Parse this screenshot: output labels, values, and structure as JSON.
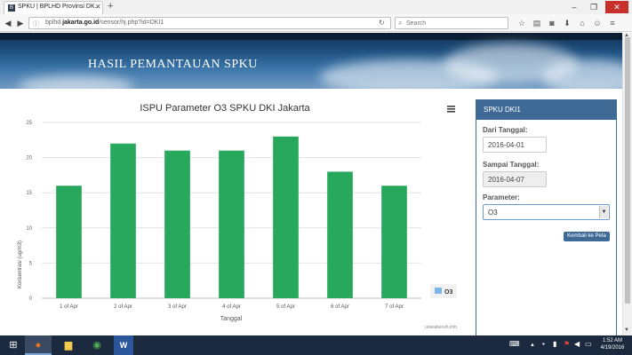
{
  "browser": {
    "tab_title": "SPKU | BPLHD Provinsi DK...",
    "url_prefix": "bplhd.",
    "url_domain": "jakarta.go.id",
    "url_path": "/sensor/hj.php?id=DKI1",
    "search_placeholder": "Search"
  },
  "banner": {
    "title": "HASIL PEMANTAUAN SPKU"
  },
  "chart_panel": {
    "menu_icon": "hamburger-icon",
    "credit": "udarabersih.info"
  },
  "chart_data": {
    "type": "bar",
    "title": "ISPU Parameter O3 SPKU DKI Jakarta",
    "categories": [
      "1 of Apr",
      "2 of Apr",
      "3 of Apr",
      "4 of Apr",
      "5 of Apr",
      "6 of Apr",
      "7 of Apr"
    ],
    "series": [
      {
        "name": "O3",
        "values": [
          16,
          22,
          21,
          21,
          23,
          18,
          16
        ]
      }
    ],
    "xlabel": "Tanggal",
    "ylabel": "Konsentrasi (ug/m3)",
    "ylim": [
      0,
      25
    ],
    "yticks": [
      0,
      5,
      10,
      15,
      20,
      25
    ],
    "grid": true,
    "legend_position": "right",
    "bar_color": "#27a85c",
    "legend_color": "#7cb5ec"
  },
  "side": {
    "header": "SPKU DKI1",
    "dari_label": "Dari Tanggal:",
    "dari_value": "2016-04-01",
    "sampai_label": "Sampai Tanggal:",
    "sampai_value": "2016-04-07",
    "param_label": "Parameter:",
    "param_value": "O3",
    "kembali_label": "Kembali ke Peta"
  },
  "taskbar": {
    "time": "1:52 AM",
    "date": "4/19/2016"
  }
}
